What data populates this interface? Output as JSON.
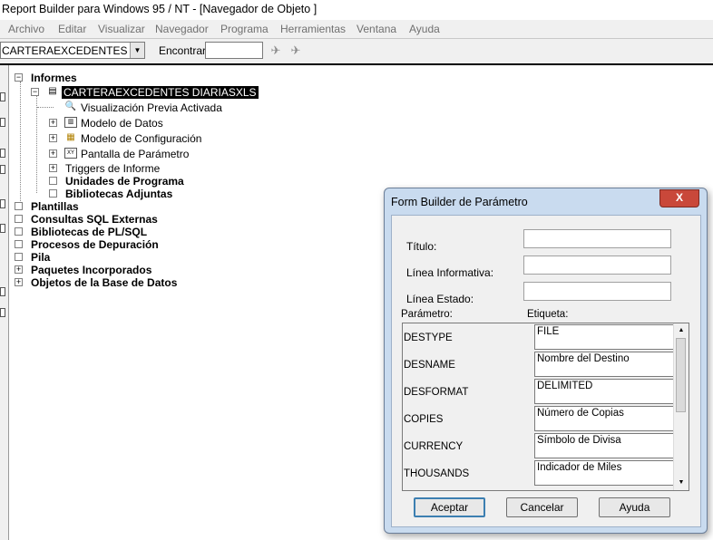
{
  "window": {
    "title": "Report Builder para Windows 95 / NT - [Navegador de Objeto ]"
  },
  "menu": [
    "Archivo",
    "Editar",
    "Visualizar",
    "Navegador",
    "Programa",
    "Herramientas",
    "Ventana",
    "Ayuda"
  ],
  "toolbar": {
    "object_combo_value": "CARTERAEXCEDENTES DIARIA",
    "find_label": "Encontrar:",
    "find_value": ""
  },
  "tree": {
    "informes": "Informes",
    "report": "CARTERAEXCEDENTES DIARIASXLS",
    "preview": "Visualización Previa Activada",
    "data_model": "Modelo de Datos",
    "layout_model": "Modelo de Configuración",
    "param_form": "Pantalla de Parámetro",
    "triggers": "Triggers de Informe",
    "program_units": "Unidades de Programa",
    "attached_libs": "Bibliotecas Adjuntas",
    "plantillas": "Plantillas",
    "sql_queries": "Consultas SQL Externas",
    "plsql_libs": "Bibliotecas de PL/SQL",
    "debug_actions": "Procesos de Depuración",
    "stack": "Pila",
    "builtin_packages": "Paquetes Incorporados",
    "db_objects": "Objetos de la Base de Datos"
  },
  "dialog": {
    "title": "Form Builder de Parámetro",
    "close": "X",
    "titulo_label": "Título:",
    "titulo_value": "",
    "linea_info_label": "Línea Informativa:",
    "linea_info_value": "",
    "linea_estado_label": "Línea Estado:",
    "linea_estado_value": "",
    "col_parametro": "Parámetro:",
    "col_etiqueta": "Etiqueta:",
    "rows": [
      {
        "param": "DESTYPE",
        "label": "FILE"
      },
      {
        "param": "DESNAME",
        "label": "Nombre del Destino"
      },
      {
        "param": "DESFORMAT",
        "label": "DELIMITED"
      },
      {
        "param": "COPIES",
        "label": "Número de Copias"
      },
      {
        "param": "CURRENCY",
        "label": "Símbolo de Divisa"
      },
      {
        "param": "THOUSANDS",
        "label": "Indicador de Miles"
      }
    ],
    "btn_ok": "Aceptar",
    "btn_cancel": "Cancelar",
    "btn_help": "Ayuda"
  }
}
